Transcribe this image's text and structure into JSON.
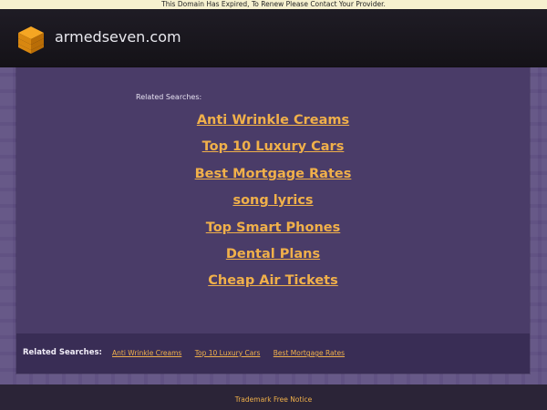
{
  "top_banner": {
    "text": "This Domain Has Expired, To Renew Please Contact Your Provider."
  },
  "header": {
    "site_name": "armedseven.com"
  },
  "related": {
    "label": "Related Searches:",
    "links": [
      "Anti Wrinkle Creams",
      "Top 10 Luxury Cars",
      "Best Mortgage Rates",
      "song lyrics",
      "Top Smart Phones",
      "Dental Plans",
      "Cheap Air Tickets"
    ]
  },
  "bottom": {
    "label": "Related Searches:",
    "links": [
      "Anti Wrinkle Creams",
      "Top 10 Luxury Cars",
      "Best Mortgage Rates"
    ]
  },
  "footer": {
    "trademark": "Trademark Free Notice"
  },
  "colors": {
    "accent": "#f0b04a",
    "header_bg": "#1a171f",
    "panel_bg": "#4a3c68",
    "bottom_bar_bg": "#392d55"
  }
}
